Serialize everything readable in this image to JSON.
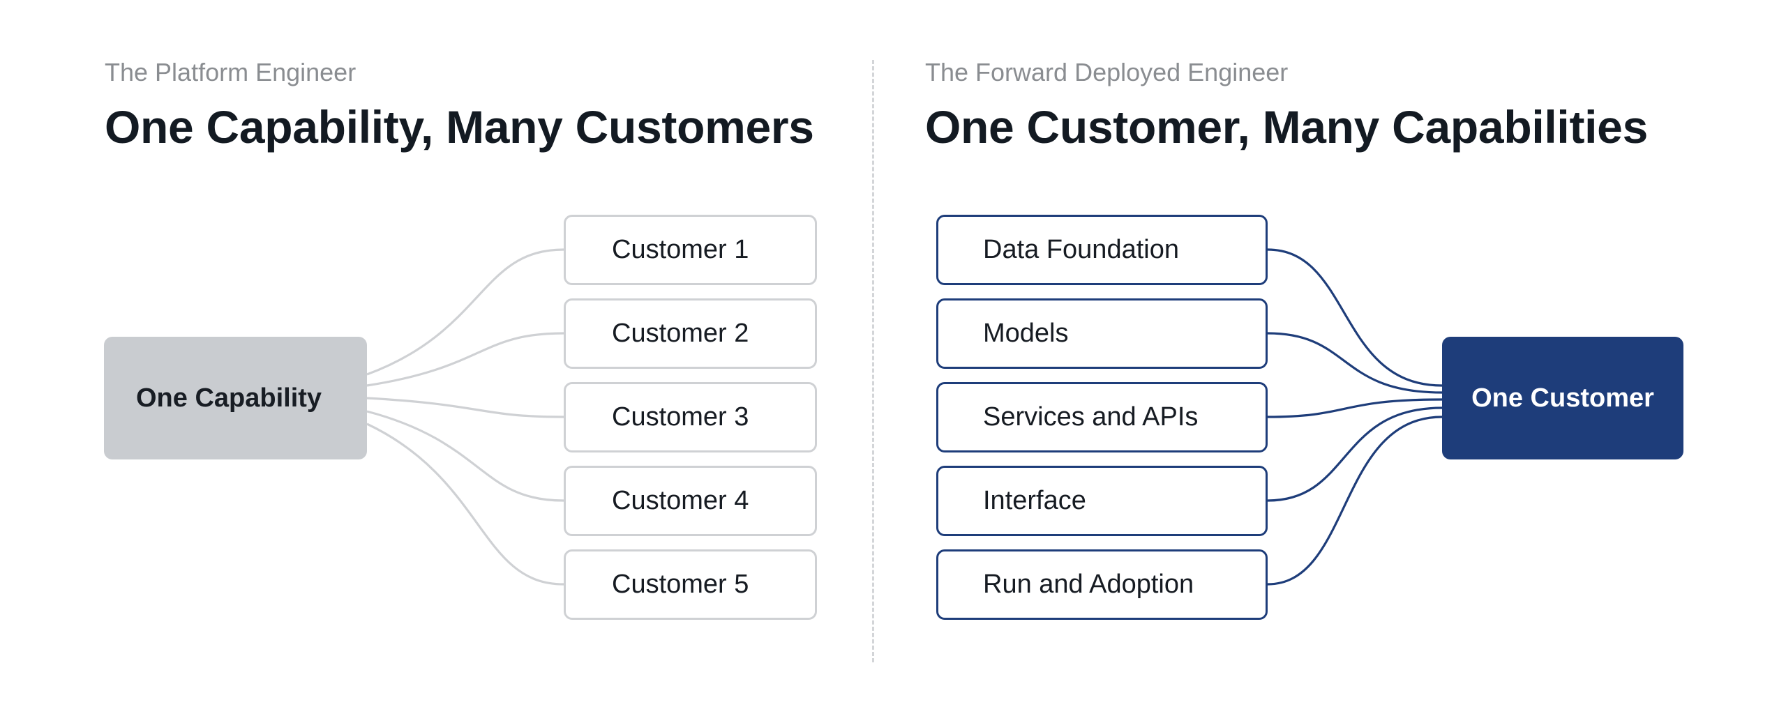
{
  "left_panel": {
    "subtitle": "The Platform Engineer",
    "title": "One Capability, Many Customers",
    "hub_label": "One Capability",
    "items": [
      {
        "label": "Customer 1"
      },
      {
        "label": "Customer 2"
      },
      {
        "label": "Customer 3"
      },
      {
        "label": "Customer 4"
      },
      {
        "label": "Customer 5"
      }
    ]
  },
  "right_panel": {
    "subtitle": "The Forward Deployed Engineer",
    "title": "One Customer, Many Capabilities",
    "hub_label": "One Customer",
    "items": [
      {
        "label": "Data Foundation"
      },
      {
        "label": "Models"
      },
      {
        "label": "Services and APIs"
      },
      {
        "label": "Interface"
      },
      {
        "label": "Run and Adoption"
      }
    ]
  },
  "colors": {
    "left_accent": "#c9ccd0",
    "left_connector": "#cfd1d4",
    "right_accent": "#1e3d7a",
    "title_text": "#131a22",
    "subtitle_text": "#8a8d91"
  }
}
